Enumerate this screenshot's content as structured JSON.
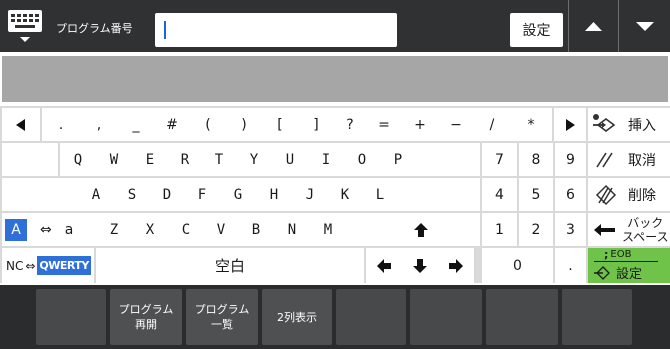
{
  "topbar": {
    "program_label": "プログラム番号",
    "program_value": "",
    "set_label": "設定"
  },
  "symbols_row": [
    ".",
    ",",
    "_",
    "#",
    "(",
    ")",
    "[",
    "]",
    "?",
    "=",
    "+",
    "−",
    "/",
    "*"
  ],
  "row_q": [
    "Q",
    "W",
    "E",
    "R",
    "T",
    "Y",
    "U",
    "I",
    "O",
    "P"
  ],
  "row_a": [
    "A",
    "S",
    "D",
    "F",
    "G",
    "H",
    "J",
    "K",
    "L"
  ],
  "row_z": [
    "Z",
    "X",
    "C",
    "V",
    "B",
    "N",
    "M"
  ],
  "keypad": {
    "r1": [
      "7",
      "8",
      "9"
    ],
    "r2": [
      "4",
      "5",
      "6"
    ],
    "r3": [
      "1",
      "2",
      "3"
    ],
    "zero": "0",
    "dot": "."
  },
  "mode": {
    "upper": "A",
    "swap": "⇔",
    "lower": "a"
  },
  "nc": {
    "label": "NC",
    "swap": "⇔",
    "qwerty": "QWERTY"
  },
  "space_label": "空白",
  "side": {
    "insert": "挿入",
    "cancel": "取消",
    "delete": "削除",
    "backspace": "バック\nスペース",
    "eob": "EOB",
    "eob_prefix": ";",
    "set": "設定"
  },
  "function_keys": [
    "",
    "プログラム\n再開",
    "プログラム\n一覧",
    "2列表示",
    "",
    "",
    "",
    "",
    ""
  ],
  "colors": {
    "accent_blue": "#2f6fd8",
    "eob_green": "#6fc349",
    "topbar": "#2f3133"
  }
}
